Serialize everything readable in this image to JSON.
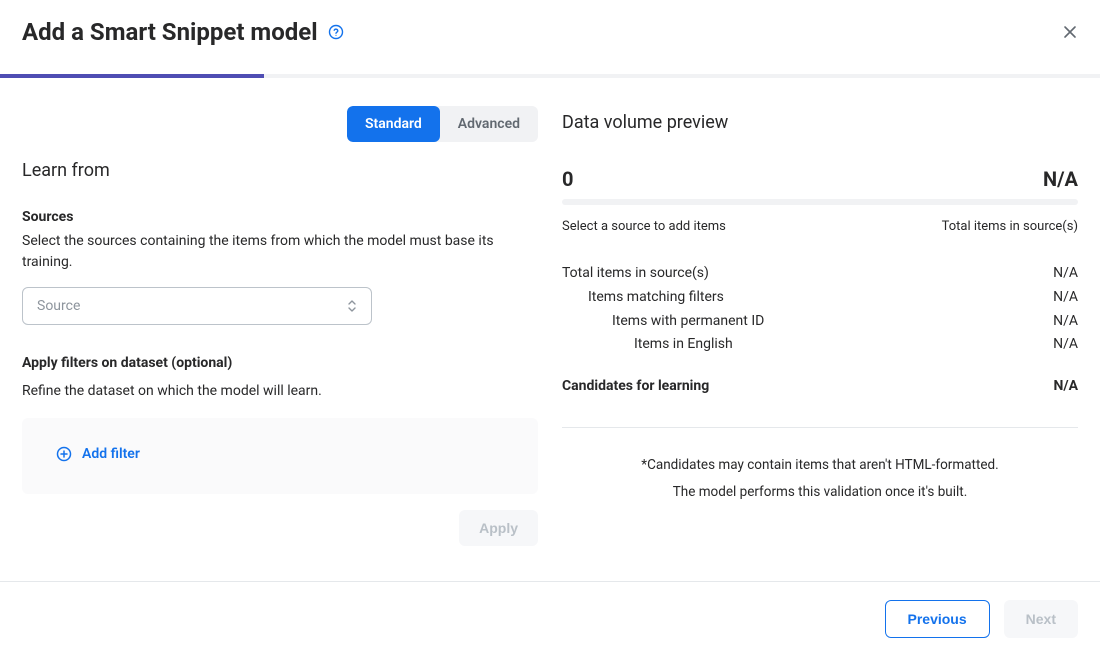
{
  "header": {
    "title": "Add a Smart Snippet model"
  },
  "progress": {
    "percent": "24%"
  },
  "tabs": {
    "standard": "Standard",
    "advanced": "Advanced",
    "active": "standard"
  },
  "learn_from": {
    "title": "Learn from",
    "sources_label": "Sources",
    "sources_help": "Select the sources containing the items from which the model must base its training.",
    "source_placeholder": "Source",
    "filters_label": "Apply filters on dataset (optional)",
    "filters_help": "Refine the dataset on which the model will learn.",
    "add_filter": "Add filter",
    "apply": "Apply"
  },
  "preview": {
    "title": "Data volume preview",
    "zero": "0",
    "na": "N/A",
    "caption_left": "Select a source to add items",
    "caption_right": "Total items in source(s)",
    "rows": [
      {
        "label": "Total items in source(s)",
        "value": "N/A",
        "indent": 0
      },
      {
        "label": "Items matching filters",
        "value": "N/A",
        "indent": 1
      },
      {
        "label": "Items with permanent ID",
        "value": "N/A",
        "indent": 2
      },
      {
        "label": "Items in English",
        "value": "N/A",
        "indent": 3
      }
    ],
    "candidates_label": "Candidates for learning",
    "candidates_value": "N/A",
    "note_line1": "*Candidates may contain items that aren't HTML-formatted.",
    "note_line2": "The model performs this validation once it's built."
  },
  "footer": {
    "previous": "Previous",
    "next": "Next"
  }
}
